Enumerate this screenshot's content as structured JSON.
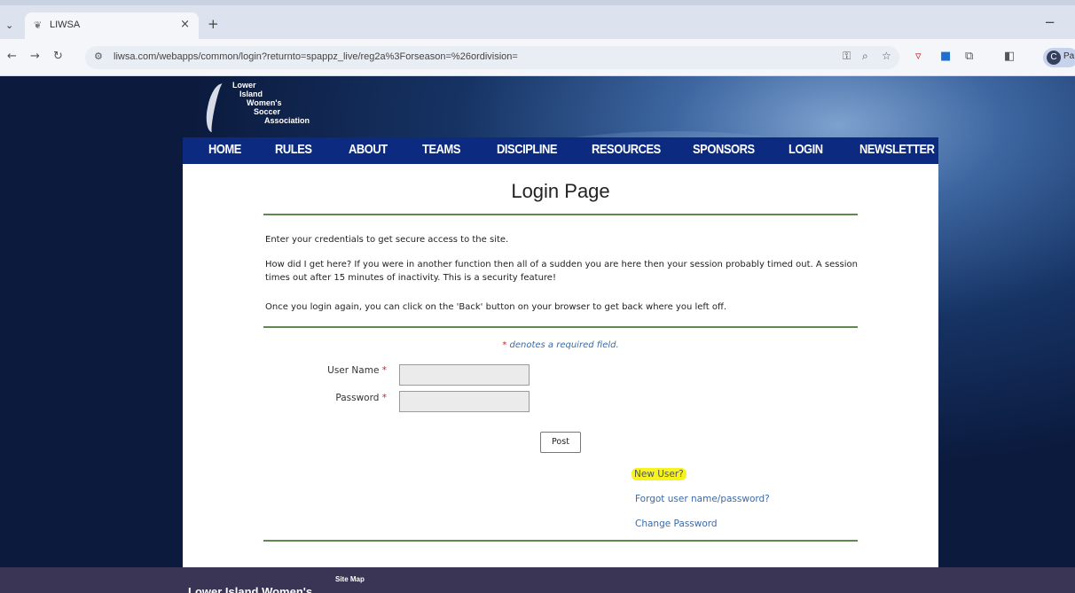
{
  "browser": {
    "tab_title": "LIWSA",
    "tab_close": "×",
    "new_tab": "+",
    "minimize": "−",
    "url": "liwsa.com/webapps/common/login?returnto=spappz_live/reg2a%3Forseason=%26ordivision=",
    "profile_initial": "C",
    "profile_text": "Pa",
    "icons": [
      "back-icon",
      "forward-icon",
      "reload-icon",
      "site-info-icon",
      "password-key-icon",
      "zoom-icon",
      "bookmark-star-icon",
      "extension-icon",
      "outlook-icon",
      "puzzle-icon",
      "sidepanel-icon"
    ]
  },
  "logo": {
    "lines": [
      "Lower",
      "Island",
      "Women's",
      "Soccer",
      "Association"
    ]
  },
  "nav": {
    "items": [
      "HOME",
      "RULES",
      "ABOUT",
      "TEAMS",
      "DISCIPLINE",
      "RESOURCES",
      "SPONSORS",
      "LOGIN",
      "NEWSLETTER"
    ]
  },
  "login": {
    "title": "Login Page",
    "intro": "Enter your credentials to get secure access to the site.",
    "timeout_note": "How did I get here? If you were in another function then all of a sudden you are here then your session probably timed out. A session times out after 15 minutes of inactivity. This is a security feature!",
    "back_note": "Once you login again, you can click on the 'Back' button on your browser to get back where you left off.",
    "required_star": "*",
    "required_note": " denotes a required field.",
    "username_label": "User Name",
    "password_label": "Password",
    "username_value": "",
    "password_value": "",
    "post_button": "Post",
    "new_user_link": "New User?",
    "forgot_link": "Forgot user name/password?",
    "change_password_link": "Change Password"
  },
  "footer": {
    "sitemap": "Site Map",
    "org_name": "Lower Island Women's"
  },
  "colors": {
    "nav_bg": "#0b2a80",
    "rule": "#5e8a4f",
    "link": "#3a6aa6",
    "required": "#c0282e",
    "highlight": "#f6f31e",
    "footer_bg": "#3a3554"
  }
}
